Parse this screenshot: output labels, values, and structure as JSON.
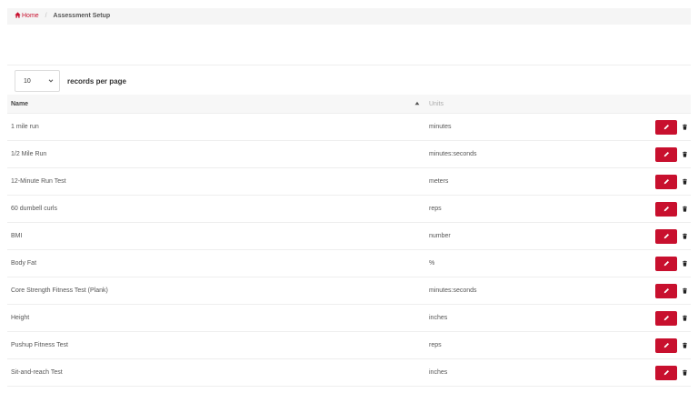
{
  "breadcrumb": {
    "home": "Home",
    "current": "Assessment Setup"
  },
  "length": {
    "value": "10",
    "label": "records per page"
  },
  "table": {
    "headers": {
      "name": "Name",
      "units": "Units"
    },
    "rows": [
      {
        "name": "1 mile run",
        "units": "minutes"
      },
      {
        "name": "1/2 Mile Run",
        "units": "minutes:seconds"
      },
      {
        "name": "12-Minute Run Test",
        "units": "meters"
      },
      {
        "name": "60 dumbell curls",
        "units": "reps"
      },
      {
        "name": "BMI",
        "units": "number"
      },
      {
        "name": "Body Fat",
        "units": "%"
      },
      {
        "name": "Core Strength Fitness Test (Plank)",
        "units": "minutes:seconds"
      },
      {
        "name": "Height",
        "units": "inches"
      },
      {
        "name": "Pushup Fitness Test",
        "units": "reps"
      },
      {
        "name": "Sit-and-reach Test",
        "units": "inches"
      }
    ]
  },
  "icons": {
    "home": "home-icon",
    "chevron": "chevron-down-icon",
    "sort": "sort-asc-icon",
    "edit": "pencil-icon",
    "delete": "trash-icon"
  },
  "colors": {
    "accent": "#c8102e"
  }
}
